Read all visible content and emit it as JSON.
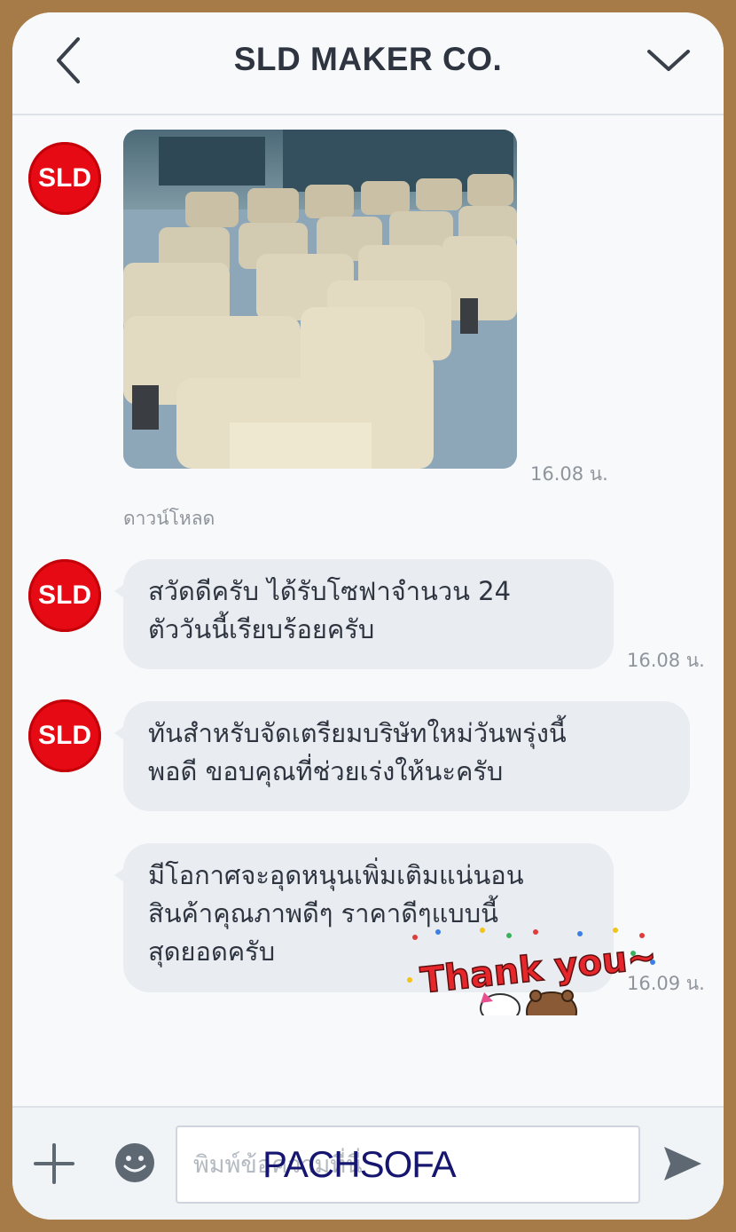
{
  "header": {
    "title": "SLD MAKER CO."
  },
  "chat": {
    "avatar_label": "SLD",
    "photo_message": {
      "time": "16.08 น.",
      "download_label": "ดาวน์โหลด"
    },
    "messages": [
      {
        "lines": [
          "สวัดดีครับ ได้รับโซฟาจำนวน 24",
          "ตัววันนี้เรียบร้อยครับ"
        ],
        "time": "16.08 น."
      },
      {
        "lines": [
          "ทันสำหรับจัดเตรียมบริษัทใหม่วันพรุ่งนี้",
          "พอดี ขอบคุณที่ช่วยเร่งให้นะครับ"
        ],
        "time": ""
      },
      {
        "lines": [
          "มีโอกาศจะอุดหนุนเพิ่มเติมแน่นอน",
          "สินค้าคุณภาพดีๆ ราคาดีๆแบบนี้",
          "สุดยอดครับ"
        ],
        "time": "16.09 น."
      }
    ],
    "sticker_text": "Thank you~"
  },
  "input": {
    "placeholder": "พิมพ์ข้อความที่นี่"
  },
  "watermark": "PACHSOFA",
  "colors": {
    "frame": "#a67b48",
    "avatar": "#e50a14",
    "bubble": "#e9edf1",
    "icon": "#5e6873",
    "watermark": "#161670"
  },
  "icons": [
    "chevron-left-icon",
    "chevron-down-icon",
    "plus-icon",
    "emoji-icon",
    "send-icon"
  ]
}
